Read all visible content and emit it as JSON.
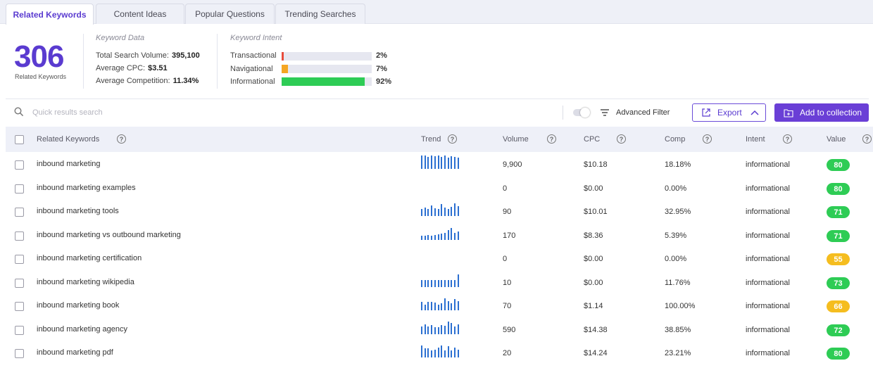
{
  "tabs": [
    {
      "label": "Related Keywords",
      "active": true
    },
    {
      "label": "Content Ideas",
      "active": false
    },
    {
      "label": "Popular Questions",
      "active": false
    },
    {
      "label": "Trending Searches",
      "active": false
    }
  ],
  "summary": {
    "count": "306",
    "count_caption": "Related Keywords",
    "keyword_data_title": "Keyword Data",
    "stats": [
      {
        "label": "Total Search Volume:",
        "value": "395,100"
      },
      {
        "label": "Average CPC:",
        "value": "$3.51"
      },
      {
        "label": "Average Competition:",
        "value": "11.34%"
      }
    ],
    "intent_title": "Keyword Intent",
    "intents": [
      {
        "label": "Transactional",
        "pct": "2%",
        "fraction": 0.02,
        "color": "#e74c3c"
      },
      {
        "label": "Navigational",
        "pct": "7%",
        "fraction": 0.07,
        "color": "#f5a623"
      },
      {
        "label": "Informational",
        "pct": "92%",
        "fraction": 0.92,
        "color": "#2ecc55"
      }
    ]
  },
  "toolbar": {
    "search_placeholder": "Quick results search",
    "advanced_filter_label": "Advanced Filter",
    "advanced_filter_on": false,
    "export_label": "Export",
    "add_label": "Add to collection"
  },
  "table": {
    "headers": {
      "keyword": "Related Keywords",
      "trend": "Trend",
      "volume": "Volume",
      "cpc": "CPC",
      "comp": "Comp",
      "intent": "Intent",
      "value": "Value"
    },
    "rows": [
      {
        "keyword": "inbound marketing",
        "trend": [
          1,
          1,
          0.9,
          1,
          0.95,
          1,
          0.9,
          1,
          0.85,
          0.95,
          0.9,
          0.85
        ],
        "volume": "9,900",
        "cpc": "$10.18",
        "comp": "18.18%",
        "intent": "informational",
        "value": "80",
        "value_color": "#2ecc55"
      },
      {
        "keyword": "inbound marketing examples",
        "trend": [],
        "volume": "0",
        "cpc": "$0.00",
        "comp": "0.00%",
        "intent": "informational",
        "value": "80",
        "value_color": "#2ecc55"
      },
      {
        "keyword": "inbound marketing tools",
        "trend": [
          0.5,
          0.65,
          0.5,
          0.8,
          0.6,
          0.5,
          0.9,
          0.65,
          0.5,
          0.7,
          0.95,
          0.75
        ],
        "volume": "90",
        "cpc": "$10.01",
        "comp": "32.95%",
        "intent": "informational",
        "value": "71",
        "value_color": "#2ecc55"
      },
      {
        "keyword": "inbound marketing vs outbound marketing",
        "trend": [
          0.3,
          0.3,
          0.35,
          0.3,
          0.35,
          0.4,
          0.45,
          0.55,
          0.75,
          0.9,
          0.55,
          0.65
        ],
        "volume": "170",
        "cpc": "$8.36",
        "comp": "5.39%",
        "intent": "informational",
        "value": "71",
        "value_color": "#2ecc55"
      },
      {
        "keyword": "inbound marketing certification",
        "trend": [],
        "volume": "0",
        "cpc": "$0.00",
        "comp": "0.00%",
        "intent": "informational",
        "value": "55",
        "value_color": "#f5bd1f"
      },
      {
        "keyword": "inbound marketing wikipedia",
        "trend": [
          0.5,
          0.5,
          0.5,
          0.5,
          0.5,
          0.5,
          0.5,
          0.5,
          0.5,
          0.5,
          0.5,
          0.95
        ],
        "volume": "10",
        "cpc": "$0.00",
        "comp": "11.76%",
        "intent": "informational",
        "value": "73",
        "value_color": "#2ecc55"
      },
      {
        "keyword": "inbound marketing book",
        "trend": [
          0.65,
          0.4,
          0.65,
          0.65,
          0.6,
          0.4,
          0.5,
          0.9,
          0.7,
          0.5,
          0.85,
          0.7
        ],
        "volume": "70",
        "cpc": "$1.14",
        "comp": "100.00%",
        "intent": "informational",
        "value": "66",
        "value_color": "#f5bd1f"
      },
      {
        "keyword": "inbound marketing agency",
        "trend": [
          0.6,
          0.75,
          0.6,
          0.7,
          0.55,
          0.5,
          0.7,
          0.65,
          0.95,
          0.85,
          0.6,
          0.75
        ],
        "volume": "590",
        "cpc": "$14.38",
        "comp": "38.85%",
        "intent": "informational",
        "value": "72",
        "value_color": "#2ecc55"
      },
      {
        "keyword": "inbound marketing pdf",
        "trend": [
          0.9,
          0.7,
          0.7,
          0.55,
          0.6,
          0.75,
          0.9,
          0.5,
          0.85,
          0.55,
          0.75,
          0.6
        ],
        "volume": "20",
        "cpc": "$14.24",
        "comp": "23.21%",
        "intent": "informational",
        "value": "80",
        "value_color": "#2ecc55"
      }
    ]
  }
}
